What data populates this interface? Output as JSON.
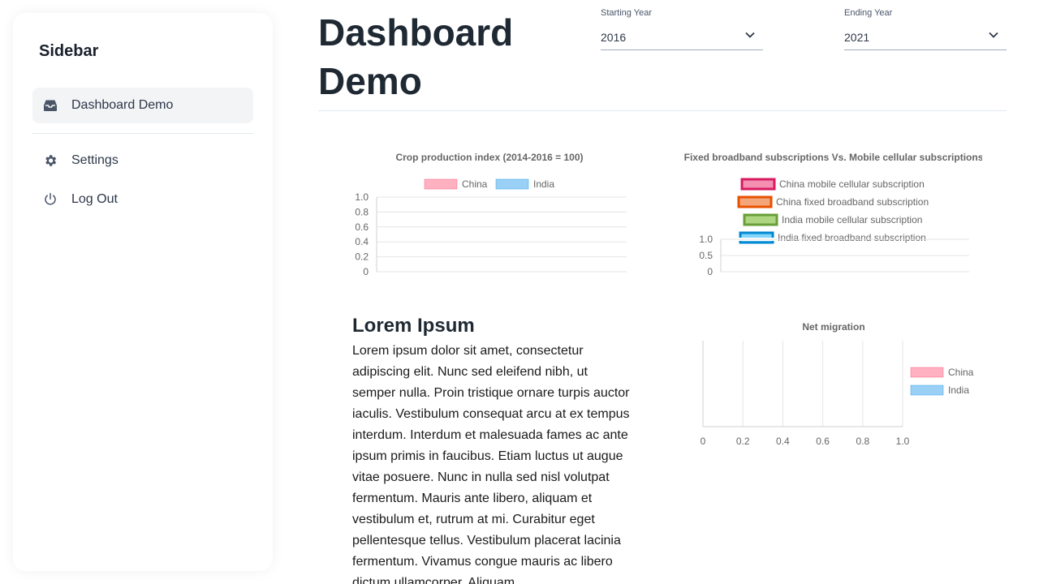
{
  "sidebar": {
    "title": "Sidebar",
    "items": [
      {
        "label": "Dashboard Demo",
        "icon": "inbox-icon"
      },
      {
        "label": "Settings",
        "icon": "gear-icon"
      },
      {
        "label": "Log Out",
        "icon": "power-icon"
      }
    ]
  },
  "header": {
    "title": "Dashboard Demo",
    "start_year": {
      "label": "Starting Year",
      "value": "2016"
    },
    "end_year": {
      "label": "Ending Year",
      "value": "2021"
    }
  },
  "content": {
    "lorem_title": "Lorem Ipsum",
    "lorem_body": "Lorem ipsum dolor sit amet, consectetur adipiscing elit. Nunc sed eleifend nibh, ut semper nulla. Proin tristique ornare turpis auctor iaculis. Vestibulum consequat arcu at ex tempus interdum. Interdum et malesuada fames ac ante ipsum primis in faucibus. Etiam luctus ut augue vitae posuere. Nunc in nulla sed nisl volutpat fermentum. Mauris ante libero, aliquam et vestibulum et, rutrum at mi. Curabitur eget pellentesque tellus. Vestibulum placerat lacinia fermentum. Vivamus congue mauris ac libero dictum ullamcorper. Aliquam"
  },
  "colors": {
    "china_fill": "#ffb1c1",
    "china_border": "#ff6384",
    "india_fill": "#9ad0f5",
    "india_border": "#36a2eb",
    "china_mobile_fill": "#f48fb1",
    "china_mobile_border": "#d81b60",
    "china_fixed_fill": "#f4a67a",
    "china_fixed_border": "#e65100",
    "india_mobile_fill": "#aed581",
    "india_mobile_border": "#689f38",
    "india_fixed_fill": "#81d4fa",
    "india_fixed_border": "#0288d1"
  },
  "chart_data": [
    {
      "type": "bar",
      "title": "Crop production index (2014-2016 = 100)",
      "series": [
        {
          "name": "China",
          "values": []
        },
        {
          "name": "India",
          "values": []
        }
      ],
      "categories": [],
      "ylim": [
        0,
        1.0
      ],
      "yticks": [
        "1.0",
        "0.8",
        "0.6",
        "0.4",
        "0.2",
        "0"
      ],
      "legend": "top",
      "grid": true
    },
    {
      "type": "bar",
      "title": "Fixed broadband subscriptions Vs. Mobile cellular subscriptions",
      "series": [
        {
          "name": "China mobile cellular subscription",
          "values": []
        },
        {
          "name": "China fixed broadband subscription",
          "values": []
        },
        {
          "name": "India mobile cellular subscription",
          "values": []
        },
        {
          "name": "India fixed broadband subscription",
          "values": []
        }
      ],
      "categories": [],
      "ylim": [
        0,
        1.0
      ],
      "yticks": [
        "1.0",
        "0.5",
        "0"
      ],
      "legend": "top",
      "grid": true
    },
    {
      "type": "bar",
      "title": "Net migration",
      "series": [
        {
          "name": "China",
          "values": []
        },
        {
          "name": "India",
          "values": []
        }
      ],
      "categories": [],
      "xlim": [
        0,
        1.0
      ],
      "xticks": [
        "0",
        "0.2",
        "0.4",
        "0.6",
        "0.8",
        "1.0"
      ],
      "legend": "right",
      "grid": true
    }
  ]
}
